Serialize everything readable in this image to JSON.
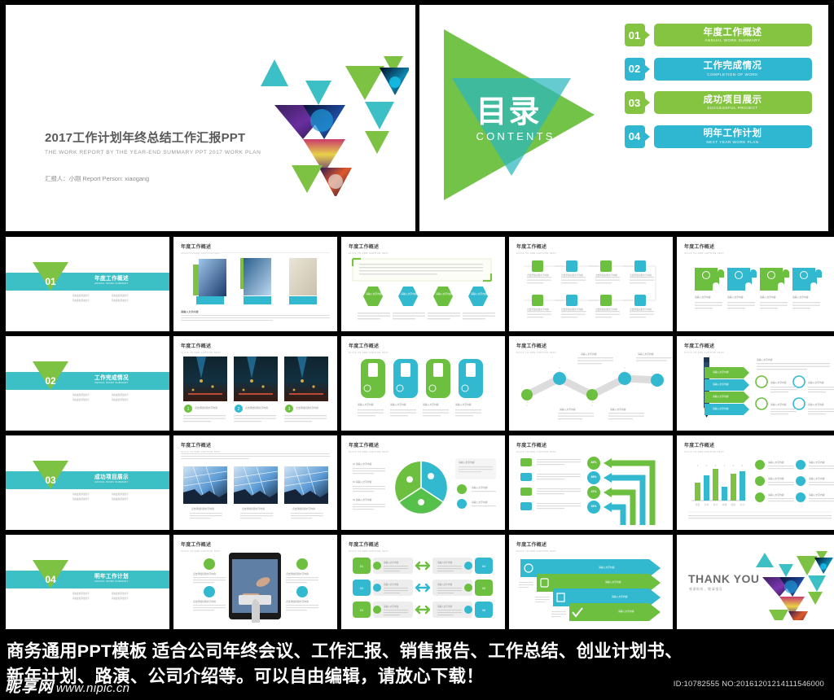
{
  "page": {
    "background": "#000000",
    "accent_green": "#7dc242",
    "accent_teal": "#32b9cf",
    "divider_band": "#3cc0c6"
  },
  "title_slide": {
    "title": "2017工作计划年终总结工作汇报PPT",
    "subtitle": "THE WORK REPORT BY THE YEAR-END SUMMARY PPT 2017 WORK PLAN",
    "presenter": "汇报人：小刚  Report Person: xiaogang"
  },
  "contents_slide": {
    "heading_cn": "目录",
    "heading_en": "CONTENTS",
    "items": [
      {
        "num": "01",
        "cn": "年度工作概述",
        "en": "ANNUAL  WORK SUMMARY",
        "color": "#84c441"
      },
      {
        "num": "02",
        "cn": "工作完成情况",
        "en": "COMPLETION OF WORK",
        "color": "#2fb6d0"
      },
      {
        "num": "03",
        "cn": "成功项目展示",
        "en": "SUCCESSFUL PROJECT",
        "color": "#84c441"
      },
      {
        "num": "04",
        "cn": "明年工作计划",
        "en": "NEXT YEAR WORK PLAN",
        "color": "#2fb6d0"
      }
    ]
  },
  "slide_header": {
    "cn": "年度工作概述",
    "en": "CLICK TO ADD CAPTION TEXT"
  },
  "section_dividers": [
    {
      "num": "01",
      "cn": "年度工作概述",
      "en": "ANNUAL WORK SUMMARY"
    },
    {
      "num": "02",
      "cn": "工作完成情况",
      "en": "ANNUAL WORK SUMMARY"
    },
    {
      "num": "03",
      "cn": "成功项目展示",
      "en": "ANNUAL WORK SUMMARY"
    },
    {
      "num": "04",
      "cn": "明年工作计划",
      "en": "ANNUAL WORK SUMMARY"
    }
  ],
  "divider_bullet": "请在此处添加文字",
  "placeholder": {
    "caption": "请输入文字内容",
    "caption_click": "点击添加标题文字内容",
    "body": "请在此处输入您的正文文字内容，点击添加相关说明文字内容。"
  },
  "thank_you": {
    "title": "THANK YOU",
    "subtitle": "感谢聆听，敬请指导"
  },
  "chart_data": {
    "type": "bar",
    "title": "年度工作概述",
    "categories": [
      "项目",
      "方案",
      "执行",
      "成果",
      "服务",
      "总计"
    ],
    "values": [
      45,
      62,
      78,
      33,
      66,
      72
    ],
    "series_colors": [
      "#7dc242",
      "#32b9cf",
      "#7dc242",
      "#32b9cf",
      "#7dc242",
      "#32b9cf"
    ],
    "xlabel": "",
    "ylabel": "",
    "ylim": [
      0,
      100
    ],
    "grid": false,
    "legend": "none"
  },
  "pie_chart": {
    "type": "pie",
    "slices": [
      {
        "label": "01 请输入文字内容",
        "value": 33,
        "color": "#7dc242"
      },
      {
        "label": "02 请输入文字内容",
        "value": 33,
        "color": "#32b9cf"
      },
      {
        "label": "03 请输入文字内容",
        "value": 34,
        "color": "#55c04a"
      }
    ]
  },
  "arrow_percentages": [
    "83%",
    "65%",
    "47%",
    "26%"
  ],
  "banner": {
    "line1": "商务通用PPT模板  适合公司年终会议、工作汇报、销售报告、工作总结、创业计划书、",
    "line2": "新年计划、路演、公司介绍等。可以自由编辑，请放心下载！",
    "id_text": "ID:10782555 NO:20161201214111546000"
  },
  "watermark": {
    "cn": "昵享网",
    "en": "www.nipic.cn"
  }
}
